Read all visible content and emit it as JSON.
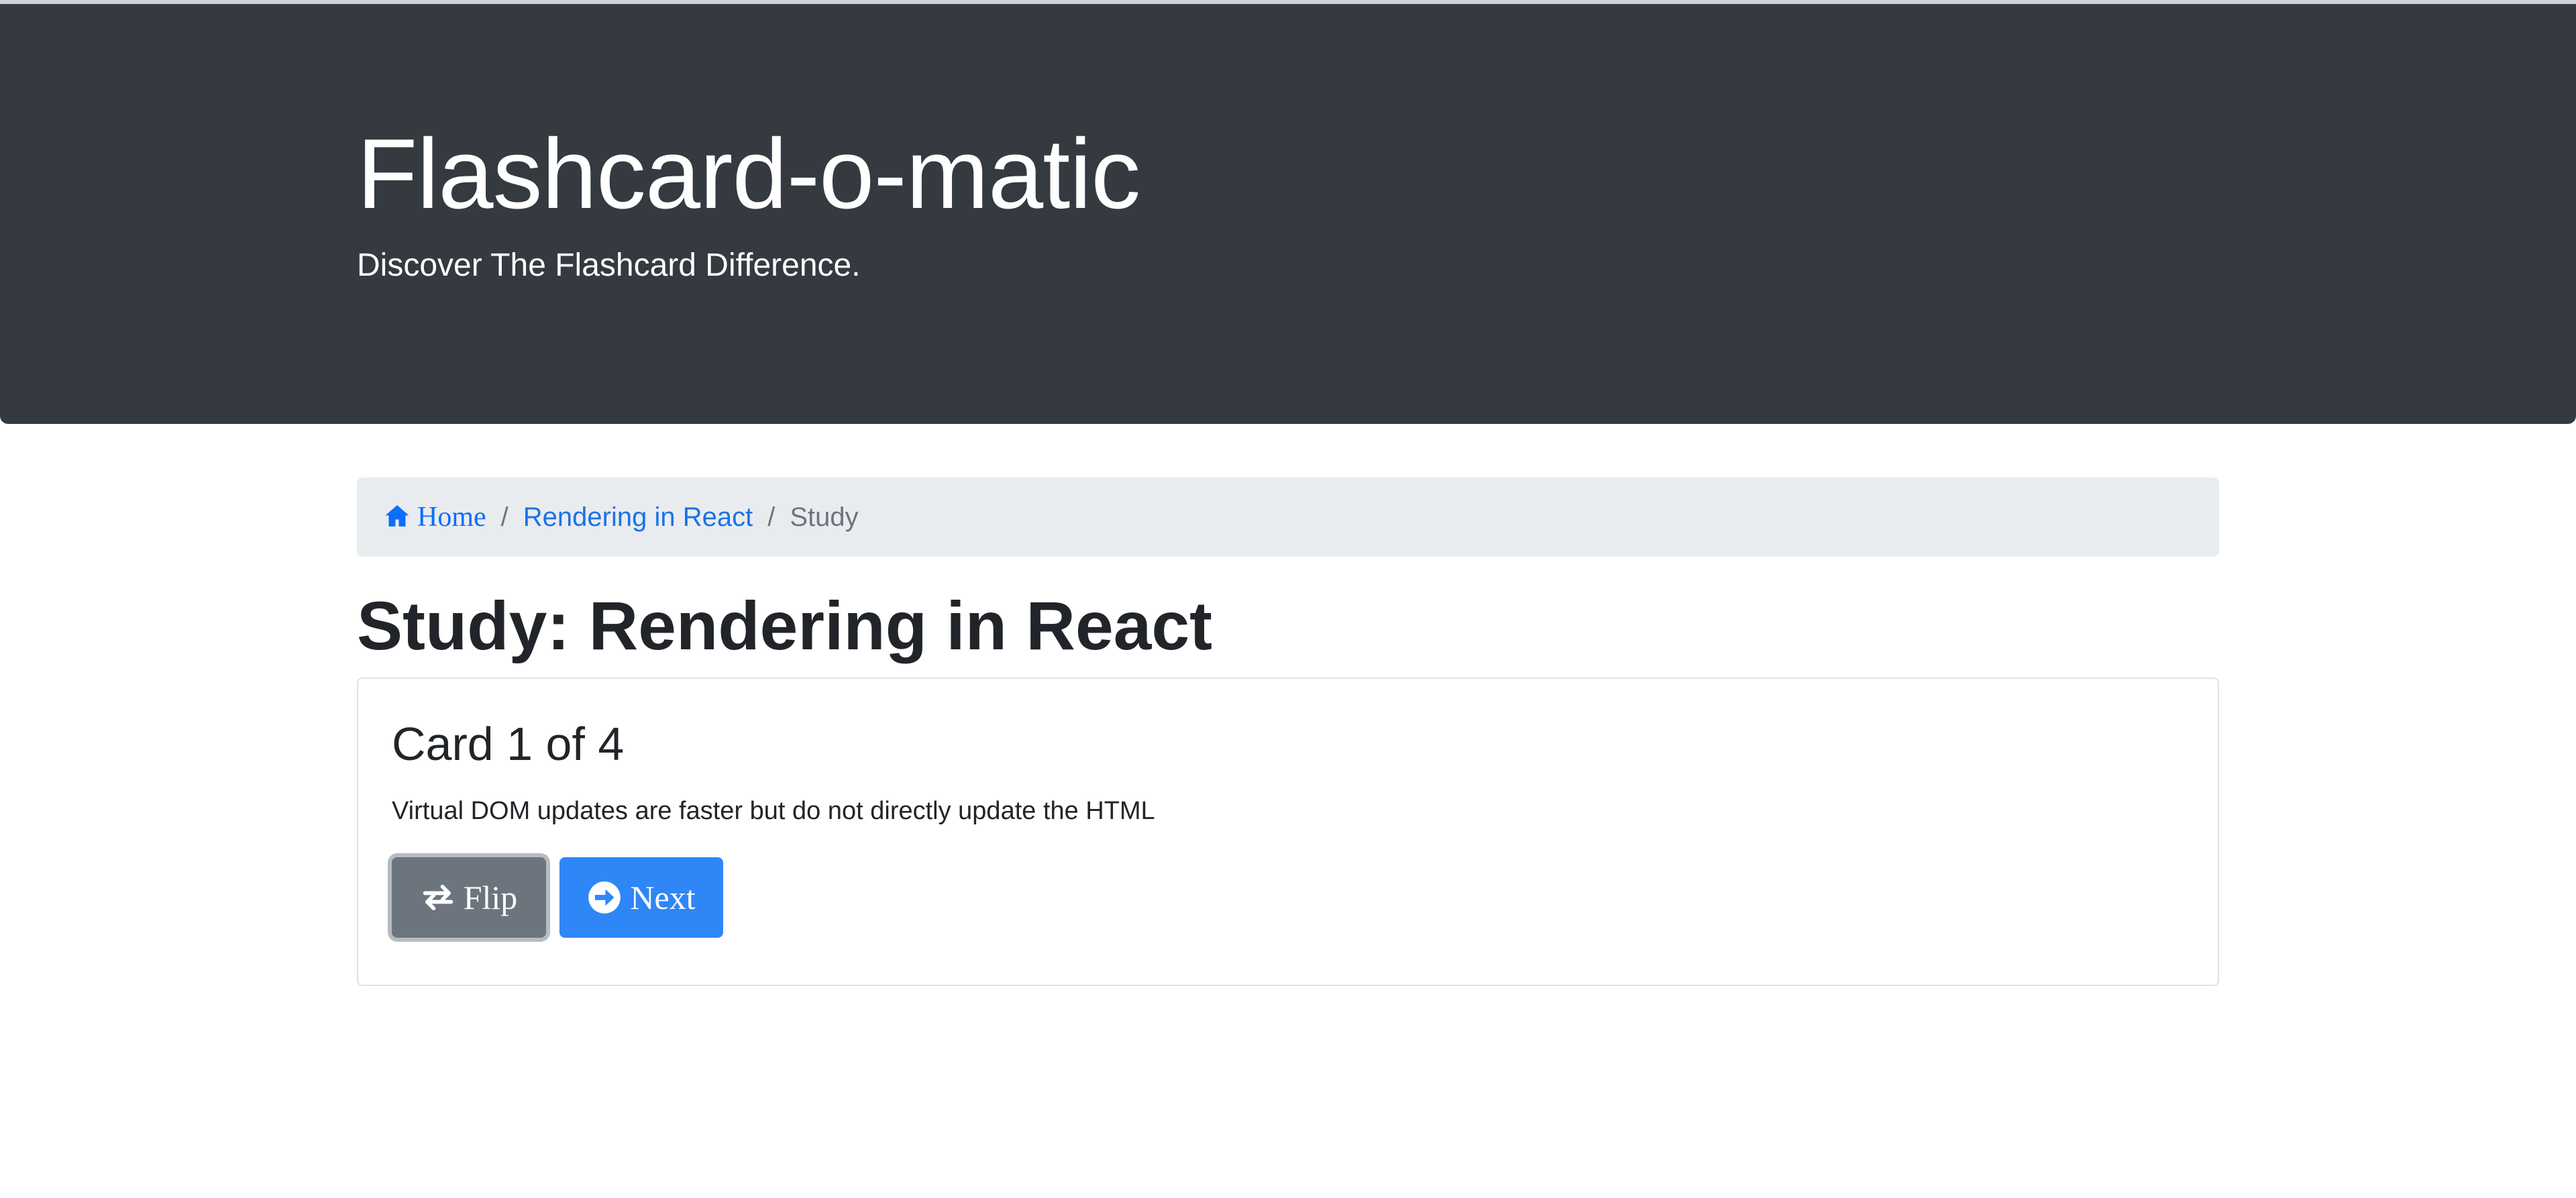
{
  "header": {
    "title": "Flashcard-o-matic",
    "subtitle": "Discover The Flashcard Difference."
  },
  "breadcrumb": {
    "home_label": "Home",
    "deck_label": "Rendering in React",
    "current_label": "Study",
    "separator": "/"
  },
  "page": {
    "title": "Study: Rendering in React"
  },
  "card": {
    "title": "Card 1 of 4",
    "text": "Virtual DOM updates are faster but do not directly update the HTML",
    "flip_label": "Flip",
    "next_label": "Next"
  },
  "icons": {
    "home": "house-icon",
    "flip": "arrows-swap-icon",
    "next": "circle-arrow-right-icon"
  },
  "colors": {
    "header_bg": "#343a40",
    "link": "#0d6efd",
    "flip_button": "#6c757d",
    "next_button": "#2f86f6",
    "breadcrumb_bg": "#e9ecef"
  }
}
